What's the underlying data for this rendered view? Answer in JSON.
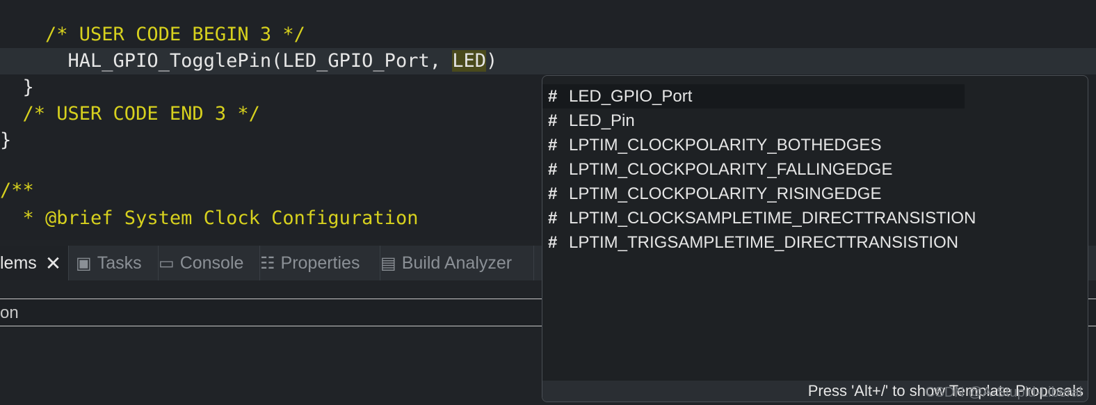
{
  "editor": {
    "lines": [
      {
        "text": "    /* USER CODE BEGIN 3 */",
        "kind": "comment"
      },
      {
        "prefix": "      HAL_GPIO_TogglePin(LED_GPIO_Port, ",
        "highlight": "LED",
        "suffix": ")",
        "kind": "code"
      },
      {
        "text": "  }",
        "kind": "code"
      },
      {
        "text": "  /* USER CODE END 3 */",
        "kind": "comment"
      },
      {
        "text": "}",
        "kind": "code"
      },
      {
        "text": "",
        "kind": "blank"
      },
      {
        "text": "/**",
        "kind": "comment"
      },
      {
        "text": "  * @brief System Clock Configuration",
        "kind": "comment"
      }
    ]
  },
  "bottom_panel": {
    "tabs": [
      {
        "label": "lems",
        "icon": "close-icon"
      },
      {
        "label": "Tasks",
        "icon": "clipboard-icon"
      },
      {
        "label": "Console",
        "icon": "monitor-icon"
      },
      {
        "label": "Properties",
        "icon": "properties-icon"
      },
      {
        "label": "Build Analyzer",
        "icon": "file-icon"
      }
    ],
    "header_text": "on"
  },
  "autocomplete": {
    "items": [
      "LED_GPIO_Port",
      "LED_Pin",
      "LPTIM_CLOCKPOLARITY_BOTHEDGES",
      "LPTIM_CLOCKPOLARITY_FALLINGEDGE",
      "LPTIM_CLOCKPOLARITY_RISINGEDGE",
      "LPTIM_CLOCKSAMPLETIME_DIRECTTRANSISTION",
      "LPTIM_TRIGSAMPLETIME_DIRECTTRANSISTION"
    ],
    "footer": "Press 'Alt+/' to show Template Proposals",
    "watermark": "CSDN @A-Stupid-Liberal"
  },
  "colors": {
    "background": "#1f2226",
    "keyword": "#d7d11e",
    "text": "#e6e6e6"
  }
}
